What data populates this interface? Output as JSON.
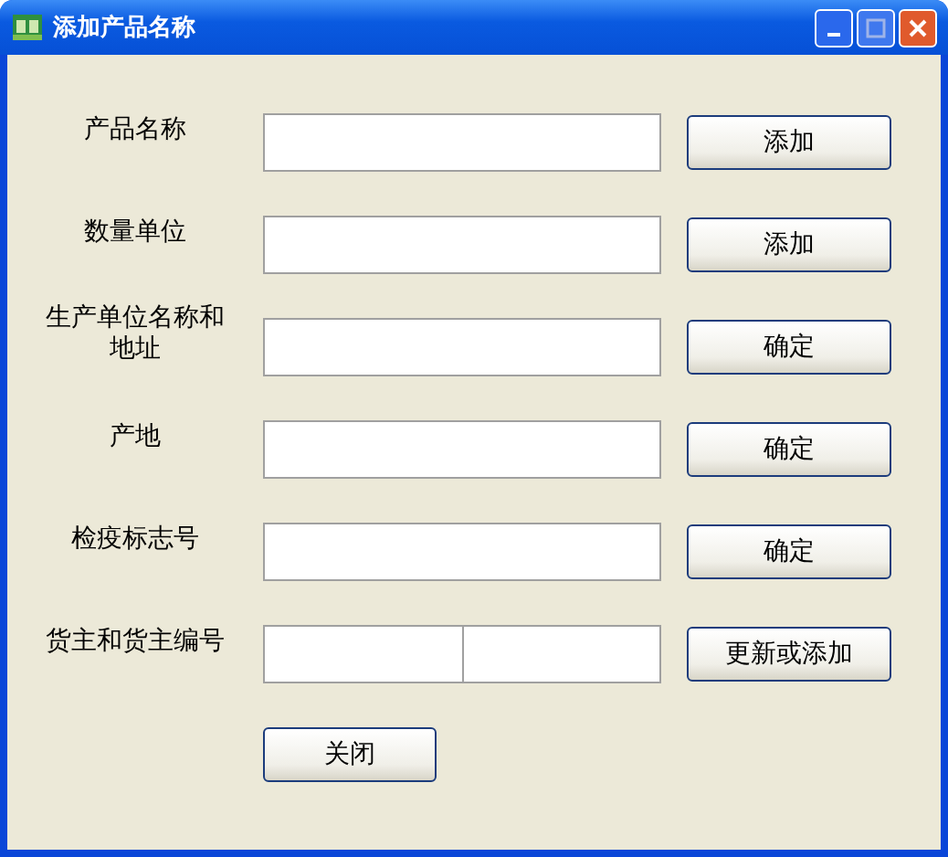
{
  "window": {
    "title": "添加产品名称"
  },
  "rows": [
    {
      "label": "产品名称",
      "kind": "single",
      "button": "添加"
    },
    {
      "label": "数量单位",
      "kind": "single",
      "button": "添加"
    },
    {
      "label": "生产单位名称和地址",
      "kind": "single",
      "button": "确定"
    },
    {
      "label": "产地",
      "kind": "single",
      "button": "确定"
    },
    {
      "label": "检疫标志号",
      "kind": "single",
      "button": "确定"
    },
    {
      "label": "货主和货主编号",
      "kind": "split",
      "button": "更新或添加"
    }
  ],
  "close_button": "关闭"
}
